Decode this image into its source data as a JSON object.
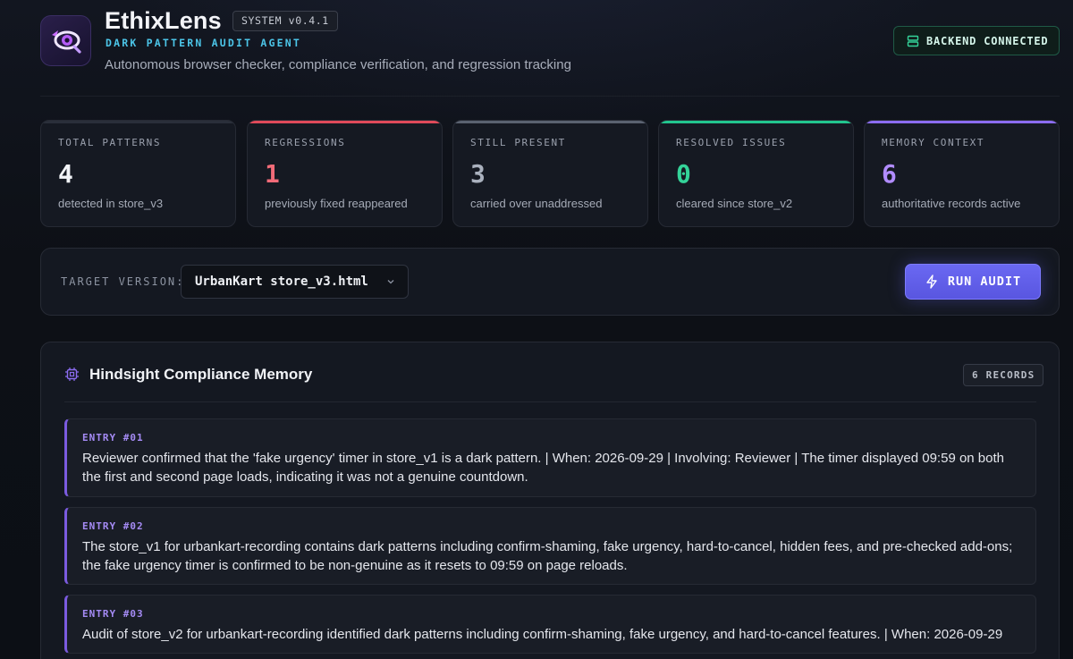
{
  "header": {
    "app_title": "EthixLens",
    "version": "SYSTEM v0.4.1",
    "subtitle": "DARK PATTERN AUDIT AGENT",
    "tagline": "Autonomous browser checker, compliance verification, and regression tracking",
    "backend_status": "BACKEND CONNECTED",
    "logo_icon": "eye-magnifier-icon"
  },
  "stats": [
    {
      "label": "TOTAL PATTERNS",
      "value": "4",
      "desc": "detected in store_v3",
      "color": "#f2f4f8",
      "accent": "#2a2f3a"
    },
    {
      "label": "REGRESSIONS",
      "value": "1",
      "desc": "previously fixed reappeared",
      "color": "#f16b78",
      "accent": "#e04a5a"
    },
    {
      "label": "STILL PRESENT",
      "value": "3",
      "desc": "carried over unaddressed",
      "color": "#aab1be",
      "accent": "#5a6270"
    },
    {
      "label": "RESOLVED ISSUES",
      "value": "0",
      "desc": "cleared since store_v2",
      "color": "#34d399",
      "accent": "#22c58e"
    },
    {
      "label": "MEMORY CONTEXT",
      "value": "6",
      "desc": "authoritative records active",
      "color": "#b18cff",
      "accent": "#8b6cf0"
    }
  ],
  "target": {
    "label": "TARGET VERSION:",
    "selected": "UrbanKart store_v3.html",
    "run_label": "RUN AUDIT"
  },
  "memory": {
    "title": "Hindsight Compliance Memory",
    "records_badge": "6 RECORDS",
    "entries": [
      {
        "id": "ENTRY #01",
        "text": "Reviewer confirmed that the 'fake urgency' timer in store_v1 is a dark pattern. | When: 2026-09-29 | Involving: Reviewer | The timer displayed 09:59 on both the first and second page loads, indicating it was not a genuine countdown."
      },
      {
        "id": "ENTRY #02",
        "text": "The store_v1 for urbankart-recording contains dark patterns including confirm-shaming, fake urgency, hard-to-cancel, hidden fees, and pre-checked add-ons; the fake urgency timer is confirmed to be non-genuine as it resets to 09:59 on page reloads."
      },
      {
        "id": "ENTRY #03",
        "text": "Audit of store_v2 for urbankart-recording identified dark patterns including confirm-shaming, fake urgency, and hard-to-cancel features. | When: 2026-09-29"
      }
    ]
  }
}
